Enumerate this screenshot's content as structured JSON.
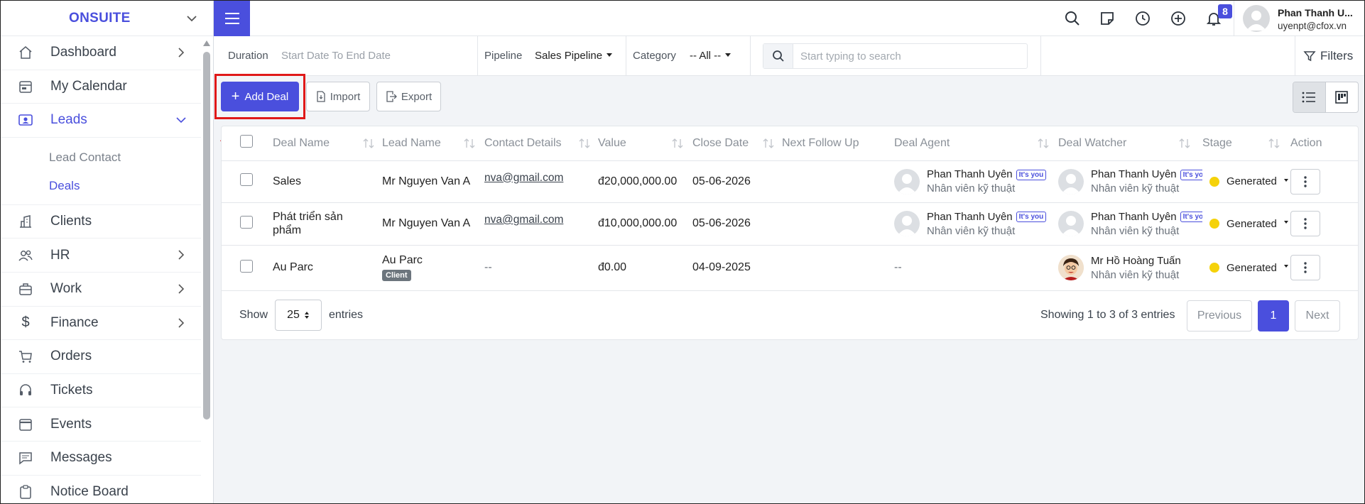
{
  "brand": {
    "name": "ONSUITE"
  },
  "sidebar": {
    "items": [
      {
        "label": "Dashboard",
        "icon": "house-icon",
        "has_chevron": true
      },
      {
        "label": "My Calendar",
        "icon": "calendar-icon",
        "has_chevron": false
      },
      {
        "label": "Leads",
        "icon": "contact-card-icon",
        "has_chevron": true,
        "expanded": true,
        "active": true,
        "children": [
          {
            "label": "Lead Contact"
          },
          {
            "label": "Deals",
            "active": true
          }
        ]
      },
      {
        "label": "Clients",
        "icon": "building-icon",
        "has_chevron": false
      },
      {
        "label": "HR",
        "icon": "people-icon",
        "has_chevron": true
      },
      {
        "label": "Work",
        "icon": "briefcase-icon",
        "has_chevron": true
      },
      {
        "label": "Finance",
        "icon": "dollar-icon",
        "has_chevron": true
      },
      {
        "label": "Orders",
        "icon": "cart-icon",
        "has_chevron": false
      },
      {
        "label": "Tickets",
        "icon": "headset-icon",
        "has_chevron": false
      },
      {
        "label": "Events",
        "icon": "calendar-event-icon",
        "has_chevron": false
      },
      {
        "label": "Messages",
        "icon": "message-icon",
        "has_chevron": false
      },
      {
        "label": "Notice Board",
        "icon": "clipboard-icon",
        "has_chevron": false
      }
    ]
  },
  "header": {
    "notification_count": "8",
    "user_name": "Phan Thanh U...",
    "user_email": "uyenpt@cfox.vn"
  },
  "filters": {
    "duration_label": "Duration",
    "duration_value": "Start Date To End Date",
    "pipeline_label": "Pipeline",
    "pipeline_value": "Sales Pipeline",
    "category_label": "Category",
    "category_value": "-- All --",
    "search_placeholder": "Start typing to search",
    "filters_label": "Filters"
  },
  "actions": {
    "add_deal": "Add Deal",
    "import": "Import",
    "export": "Export"
  },
  "table": {
    "columns": [
      "Deal Name",
      "Lead Name",
      "Contact Details",
      "Value",
      "Close Date",
      "Next Follow Up",
      "Deal Agent",
      "Deal Watcher",
      "Stage",
      "Action"
    ],
    "rows": [
      {
        "deal_name": "Sales",
        "lead_name": "Mr Nguyen Van A",
        "lead_badge": "",
        "contact": "nva@gmail.com",
        "value": "đ20,000,000.00",
        "close_date": "05-06-2026",
        "next_follow_up": "",
        "agent_name": "Phan Thanh Uyên",
        "agent_role": "Nhân viên kỹ thuật",
        "agent_tag": "It's you",
        "watcher_name": "Phan Thanh Uyên",
        "watcher_role": "Nhân viên kỹ thuật",
        "watcher_tag": "It's you",
        "stage": "Generated"
      },
      {
        "deal_name": "Phát triển sản phẩm",
        "lead_name": "Mr Nguyen Van A",
        "lead_badge": "",
        "contact": "nva@gmail.com",
        "value": "đ10,000,000.00",
        "close_date": "05-06-2026",
        "next_follow_up": "",
        "agent_name": "Phan Thanh Uyên",
        "agent_role": "Nhân viên kỹ thuật",
        "agent_tag": "It's you",
        "watcher_name": "Phan Thanh Uyên",
        "watcher_role": "Nhân viên kỹ thuật",
        "watcher_tag": "It's you",
        "stage": "Generated"
      },
      {
        "deal_name": "Au Parc",
        "lead_name": "Au Parc",
        "lead_badge": "Client",
        "contact": "--",
        "value": "đ0.00",
        "close_date": "04-09-2025",
        "next_follow_up": "",
        "agent_name": "--",
        "agent_role": "",
        "agent_tag": "",
        "watcher_name": "Mr Hồ Hoàng Tuấn",
        "watcher_role": "Nhân viên kỹ thuật",
        "watcher_tag": "",
        "stage": "Generated"
      }
    ]
  },
  "footer": {
    "show_label": "Show",
    "entries_value": "25",
    "entries_label": "entries",
    "showing_text": "Showing 1 to 3 of 3 entries",
    "previous": "Previous",
    "current_page": "1",
    "next": "Next"
  },
  "colors": {
    "accent": "#4a4fdd",
    "stage_dot": "#f5d20a",
    "annotation_red": "#e01919"
  }
}
